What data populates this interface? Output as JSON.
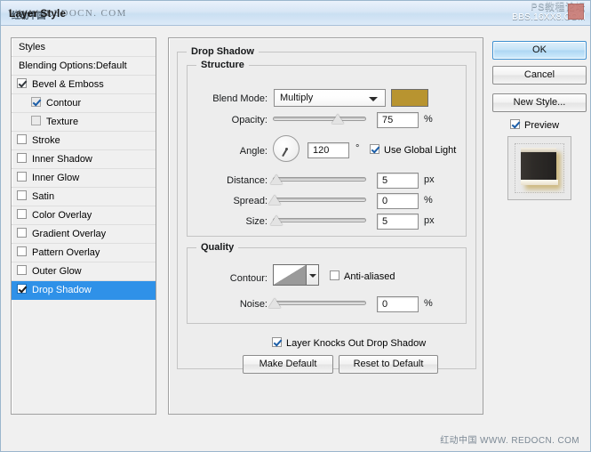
{
  "window": {
    "title": "Layer Style",
    "watermark_overlay_latin": "WWW. REDOCN. COM",
    "watermark_overlay_cn": "红动中国",
    "brand_line1": "PS教程论坛",
    "brand_line2": "BBS.16XX8.COM"
  },
  "styles_panel": {
    "header": "Styles",
    "blending_options": "Blending Options:Default",
    "items": [
      {
        "label": "Bevel & Emboss",
        "checked": true,
        "sub": false,
        "selected": false
      },
      {
        "label": "Contour",
        "checked": true,
        "sub": true,
        "selected": false
      },
      {
        "label": "Texture",
        "checked": false,
        "sub": true,
        "selected": false
      },
      {
        "label": "Stroke",
        "checked": false,
        "sub": false,
        "selected": false
      },
      {
        "label": "Inner Shadow",
        "checked": false,
        "sub": false,
        "selected": false
      },
      {
        "label": "Inner Glow",
        "checked": false,
        "sub": false,
        "selected": false
      },
      {
        "label": "Satin",
        "checked": false,
        "sub": false,
        "selected": false
      },
      {
        "label": "Color Overlay",
        "checked": false,
        "sub": false,
        "selected": false
      },
      {
        "label": "Gradient Overlay",
        "checked": false,
        "sub": false,
        "selected": false
      },
      {
        "label": "Pattern Overlay",
        "checked": false,
        "sub": false,
        "selected": false
      },
      {
        "label": "Outer Glow",
        "checked": false,
        "sub": false,
        "selected": false
      },
      {
        "label": "Drop Shadow",
        "checked": true,
        "sub": false,
        "selected": true
      }
    ]
  },
  "drop_shadow": {
    "group_title": "Drop Shadow",
    "structure": {
      "title": "Structure",
      "blend_mode_label": "Blend Mode:",
      "blend_mode_value": "Multiply",
      "shadow_color": "#b89430",
      "opacity_label": "Opacity:",
      "opacity_value": "75",
      "opacity_unit": "%",
      "opacity_percent": 75,
      "angle_label": "Angle:",
      "angle_value": "120",
      "angle_unit": "°",
      "angle_degrees": 120,
      "use_global_light": "Use Global Light",
      "use_global_light_checked": true,
      "distance_label": "Distance:",
      "distance_value": "5",
      "distance_unit": "px",
      "distance_percent": 2,
      "spread_label": "Spread:",
      "spread_value": "0",
      "spread_unit": "%",
      "spread_percent": 0,
      "size_label": "Size:",
      "size_value": "5",
      "size_unit": "px",
      "size_percent": 2
    },
    "quality": {
      "title": "Quality",
      "contour_label": "Contour:",
      "anti_aliased": "Anti-aliased",
      "anti_aliased_checked": false,
      "noise_label": "Noise:",
      "noise_value": "0",
      "noise_unit": "%",
      "noise_percent": 0
    },
    "knockout_label": "Layer Knocks Out Drop Shadow",
    "knockout_checked": true,
    "make_default": "Make Default",
    "reset_to_default": "Reset to Default"
  },
  "actions": {
    "ok": "OK",
    "cancel": "Cancel",
    "new_style": "New Style...",
    "preview": "Preview",
    "preview_checked": true
  },
  "footer": {
    "watermark_cn": "红动中国",
    "watermark_url": "WWW. REDOCN. COM"
  }
}
